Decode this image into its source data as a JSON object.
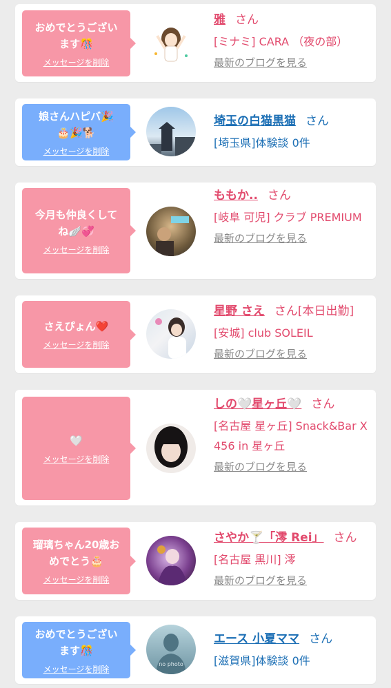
{
  "delete_label": "メッセージを削除",
  "blog_label": "最新のブログを見る",
  "san_label": "さん",
  "colors": {
    "pink_bubble": "#f797a7",
    "blue_bubble": "#79aefc",
    "pink_text": "#e24a6d",
    "blue_text": "#1c6fb5",
    "grey_link": "#8a8a8a"
  },
  "items": [
    {
      "message": "おめでとうござい\nます🎊",
      "bubble": "pink",
      "name": "雅",
      "tag": "",
      "shop": "[ミナミ] CARA （夜の部）",
      "text_color": "pink",
      "has_blog": true,
      "avatar_icon": "cheering-girl-illustration"
    },
    {
      "message": "娘さんハピバ🎉\n🎂🎉🐕",
      "bubble": "blue",
      "name": "埼玉の白猫黒猫",
      "tag": "",
      "shop": "[埼玉県]体験談 0件",
      "text_color": "blue",
      "has_blog": false,
      "avatar_icon": "castle-photo"
    },
    {
      "message": "今月も仲良くして\nね🪽💞",
      "bubble": "pink",
      "name": "ももか..",
      "tag": "",
      "shop": "[岐阜 可児] クラブ PREMIUM",
      "text_color": "pink",
      "has_blog": true,
      "avatar_icon": "club-photo"
    },
    {
      "message": "さえぴょん❤️",
      "bubble": "pink",
      "name": "星野 さえ",
      "tag": "[本日出勤]",
      "shop": "[安城] club SOLEIL",
      "text_color": "pink",
      "has_blog": true,
      "avatar_icon": "woman-photo"
    },
    {
      "message": "🤍",
      "bubble": "pink",
      "name": "しの🤍星ヶ丘🤍",
      "tag": "",
      "shop": "[名古屋 星ヶ丘] Snack&Bar X 456 in 星ヶ丘",
      "text_color": "pink",
      "has_blog": true,
      "avatar_icon": "woman-portrait-photo"
    },
    {
      "message": "瑠璃ちゃん20歳お\nめでとう🎂",
      "bubble": "pink",
      "name": "さやか🍸「澪 Rei」",
      "tag": "",
      "shop": "[名古屋 黒川] 澪",
      "text_color": "pink",
      "has_blog": true,
      "avatar_icon": "purple-costume-photo"
    },
    {
      "message": "おめでとうござい\nます🎊",
      "bubble": "blue",
      "name": "エース 小夏ママ",
      "tag": "",
      "shop": "[滋賀県]体験談 0件",
      "text_color": "blue",
      "has_blog": false,
      "avatar_icon": "no-photo-silhouette",
      "avatar_caption": "no photo"
    }
  ]
}
